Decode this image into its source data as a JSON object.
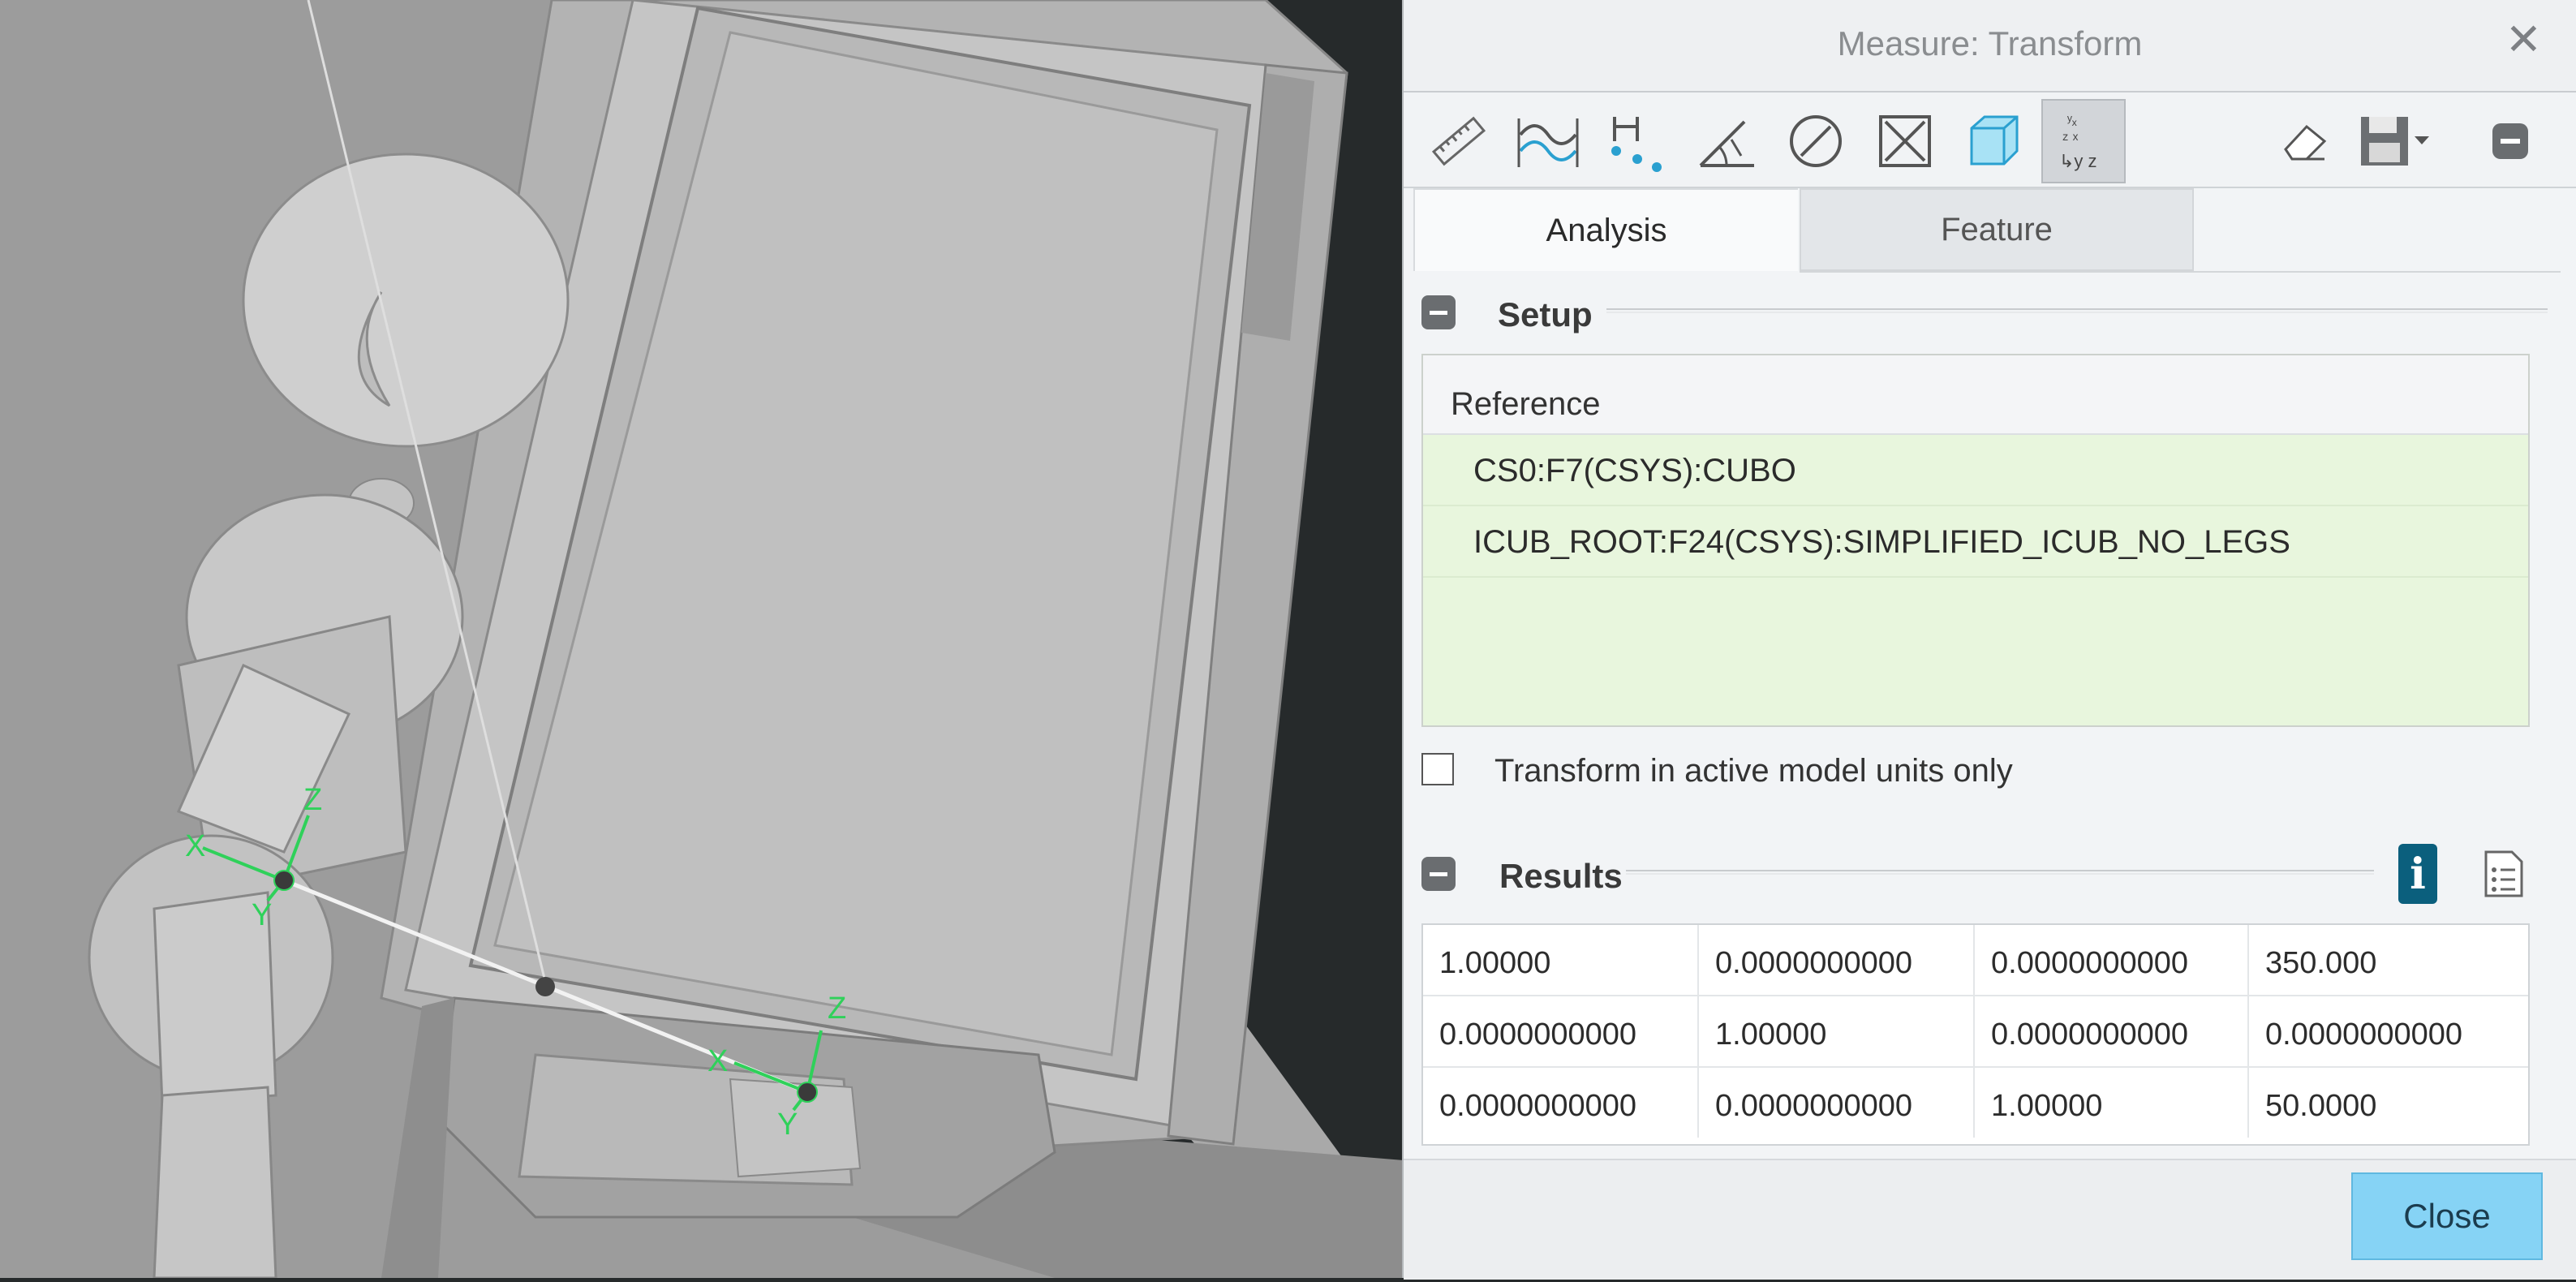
{
  "dialog": {
    "title": "Measure: Transform",
    "close_glyph": "✕",
    "toolbar": [
      {
        "name": "length-tool",
        "icon": "ruler-icon"
      },
      {
        "name": "distance-tool",
        "icon": "curve-distance-icon"
      },
      {
        "name": "dimension-tool",
        "icon": "points-distance-icon"
      },
      {
        "name": "angle-tool",
        "icon": "angle-icon"
      },
      {
        "name": "diameter-tool",
        "icon": "diameter-icon"
      },
      {
        "name": "area-tool",
        "icon": "area-icon"
      },
      {
        "name": "volume-tool",
        "icon": "volume-cube-icon"
      },
      {
        "name": "transform-tool",
        "icon": "transform-xyz-icon",
        "active": true
      },
      {
        "name": "clear-tool",
        "icon": "eraser-icon"
      },
      {
        "name": "save-tool",
        "icon": "save-disk-icon"
      },
      {
        "name": "collapse-tool",
        "icon": "minus-icon"
      }
    ],
    "tabs": [
      {
        "label": "Analysis",
        "active": true
      },
      {
        "label": "Feature",
        "active": false
      }
    ],
    "setup": {
      "title": "Setup",
      "reference_header": "Reference",
      "references": [
        "CS0:F7(CSYS):CUBO",
        "ICUB_ROOT:F24(CSYS):SIMPLIFIED_ICUB_NO_LEGS"
      ],
      "checkbox_label": "Transform in active model units only",
      "checkbox_checked": false
    },
    "results": {
      "title": "Results",
      "info_glyph": "i",
      "matrix": [
        [
          "1.00000",
          "0.0000000000",
          "0.0000000000",
          "350.000"
        ],
        [
          "0.0000000000",
          "1.00000",
          "0.0000000000",
          "0.0000000000"
        ],
        [
          "0.0000000000",
          "0.0000000000",
          "1.00000",
          "50.0000"
        ]
      ]
    },
    "close_label": "Close"
  },
  "viewport": {
    "csys_labels": {
      "x": "X",
      "y": "Y",
      "z": "Z"
    },
    "colors": {
      "background": "#262a2b",
      "model": "#b4b4b4",
      "axis": "#2fd15a",
      "accent": "#86d3f5"
    }
  }
}
